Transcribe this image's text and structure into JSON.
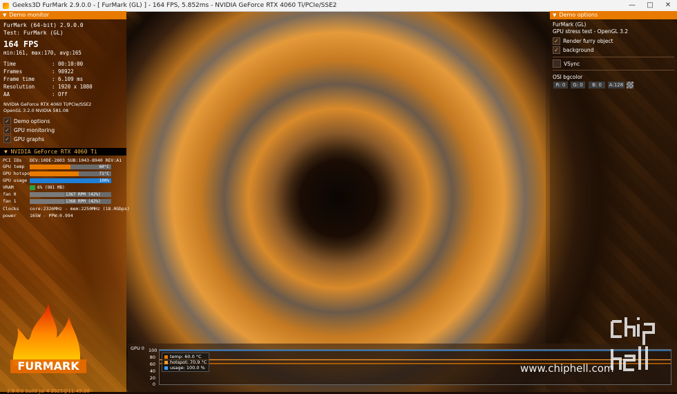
{
  "window": {
    "title": "Geeks3D FurMark 2.9.0.0 - [ FurMark (GL) ] - 164 FPS, 5.852ms - NVIDIA GeForce RTX 4060 Ti/PCIe/SSE2"
  },
  "demo_monitor": {
    "header": "Demo monitor",
    "app_line": "FurMark (64-bit) 2.9.0.0",
    "test_line": "Test: FurMark (GL)",
    "fps": "164 FPS",
    "minmax": "min:161, max:170, avg:165",
    "stats": [
      {
        "k": "Time",
        "v": ": 00:10:00"
      },
      {
        "k": "Frames",
        "v": ": 98922"
      },
      {
        "k": "Frame time",
        "v": ": 6.109 ms"
      },
      {
        "k": "Resolution",
        "v": ": 1920 x 1080"
      },
      {
        "k": "AA",
        "v": ": Off"
      }
    ],
    "renderer": "NVIDIA GeForce RTX 4060 Ti/PCIe/SSE2",
    "opengl": "OpenGL 3.2.0 NVIDIA 581.08",
    "checks": [
      "Demo options",
      "GPU monitoring",
      "GPU graphs"
    ]
  },
  "gpu": {
    "header": "NVIDIA GeForce RTX 4060 Ti",
    "pci_k": "PCI IDs",
    "pci_v": "DEV:10DE-2803 SUB:1043-8940 REV:A1",
    "bars": [
      {
        "k": "GPU temp",
        "v": "60°C",
        "level": 0.5,
        "color": "#e87a00"
      },
      {
        "k": "GPU hotspot",
        "v": "71°C",
        "level": 0.6,
        "color": "#e87a00"
      },
      {
        "k": "GPU usage",
        "v": "100%",
        "level": 1.0,
        "color": "#1f7fd6"
      },
      {
        "k": "VRAM",
        "v": "6% (981 MB)",
        "level": 0.06,
        "color": "#2e9e3e"
      },
      {
        "k": "fan 0",
        "v": "1367 RPM (42%)",
        "level": 0.42,
        "color": "#7a7a7a"
      },
      {
        "k": "fan 1",
        "v": "1368 RPM (42%)",
        "level": 0.42,
        "color": "#7a7a7a"
      }
    ],
    "clocks_k": "Clocks",
    "clocks_v": "core:2326MHz - mem:2250MHz (18.0Gbps)",
    "power_k": "power",
    "power_v": "165W - PPW:0.994"
  },
  "build_info": "2.9.0.0 build Jul  4 2025@11:45:20",
  "demo_options": {
    "header": "Demo options",
    "name": "FurMark (GL)",
    "desc": "GPU stress test - OpenGL 3.2",
    "render_furry": "Render furry object",
    "background": "background",
    "vsync": "VSync",
    "osi_label": "OSI bgcolor",
    "r": "R: 0",
    "g": "G: 0",
    "b": "B: 0",
    "a": "A:128"
  },
  "graph": {
    "label": "GPU 0",
    "axis": [
      "100",
      "80",
      "60",
      "40",
      "20",
      "0"
    ],
    "legend": [
      {
        "text": "temp: 60.0 °C",
        "color": "#e87a00"
      },
      {
        "text": "hotspot: 70.9 °C",
        "color": "#ff9a2a"
      },
      {
        "text": "usage: 100.0 %",
        "color": "#3aa0ff"
      }
    ],
    "chart_data": {
      "type": "line",
      "ylim": [
        0,
        100
      ],
      "series": [
        {
          "name": "temp",
          "values": [
            60,
            60,
            60,
            60,
            60,
            60,
            60,
            60
          ]
        },
        {
          "name": "hotspot",
          "values": [
            71,
            71,
            71,
            71,
            71,
            71,
            71,
            71
          ]
        },
        {
          "name": "usage",
          "values": [
            100,
            100,
            100,
            100,
            100,
            100,
            100,
            100
          ]
        }
      ]
    }
  },
  "watermark": {
    "site": "www.chiphell.com"
  }
}
